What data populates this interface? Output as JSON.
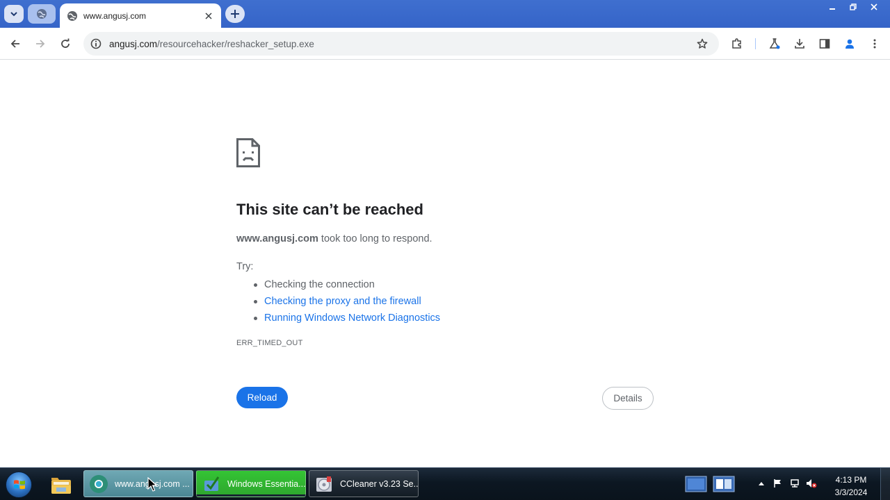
{
  "browser": {
    "tab": {
      "title": "www.angusj.com"
    },
    "address": {
      "host": "angusj.com",
      "path": "/resourcehacker/reshacker_setup.exe"
    }
  },
  "error_page": {
    "title": "This site can’t be reached",
    "host": "www.angusj.com",
    "message_suffix": " took too long to respond.",
    "try_label": "Try:",
    "suggestions": [
      "Checking the connection",
      "Checking the proxy and the firewall",
      "Running Windows Network Diagnostics"
    ],
    "error_code": "ERR_TIMED_OUT",
    "reload_label": "Reload",
    "details_label": "Details"
  },
  "taskbar": {
    "items": [
      {
        "label": "www.angusj.com ...",
        "icon": "chrome-icon"
      },
      {
        "label": "Windows Essentia...",
        "icon": "windows-essentials-icon"
      },
      {
        "label": "CCleaner v3.23 Se...",
        "icon": "ccleaner-icon"
      }
    ],
    "clock": {
      "time": "4:13 PM",
      "date": "3/3/2024"
    }
  },
  "colors": {
    "accent": "#1a73e8",
    "tabstrip": "#3564c8",
    "taskbar": "#0c1722"
  }
}
